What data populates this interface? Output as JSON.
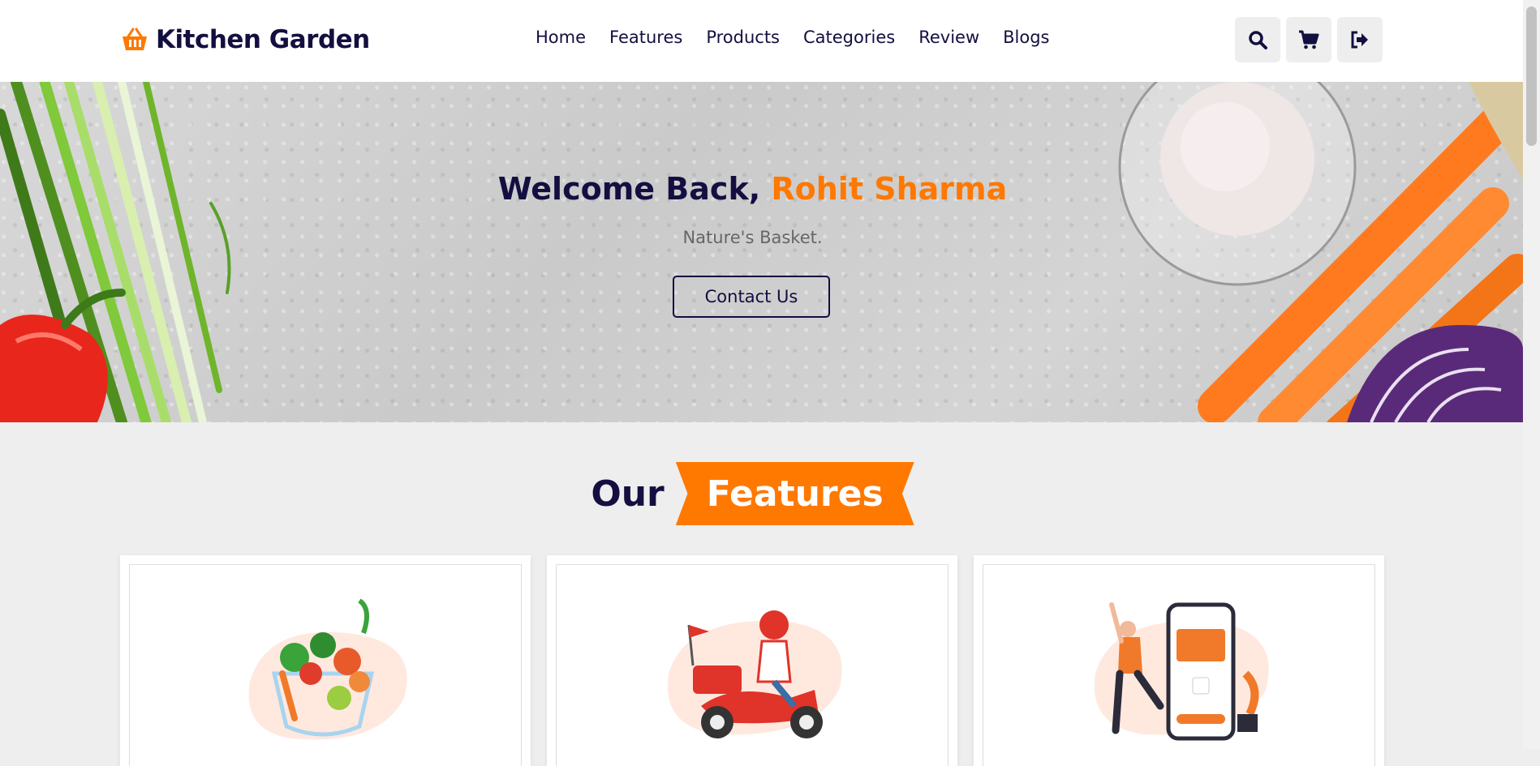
{
  "brand": {
    "name": "Kitchen Garden",
    "icon": "basket-icon",
    "accent": "#ff7800",
    "dark": "#130f40"
  },
  "nav": {
    "items": [
      "Home",
      "Features",
      "Products",
      "Categories",
      "Review",
      "Blogs"
    ]
  },
  "header_icons": [
    "search-icon",
    "cart-icon",
    "logout-icon"
  ],
  "hero": {
    "welcome": "Welcome Back, ",
    "user_name": "Rohit Sharma",
    "subtitle": "Nature's Basket.",
    "button_label": "Contact Us"
  },
  "features": {
    "heading_part1": "Our",
    "heading_part2": "Features",
    "cards": [
      {
        "image": "fresh-vegetables-illustration"
      },
      {
        "image": "delivery-scooter-illustration"
      },
      {
        "image": "mobile-payment-illustration"
      }
    ]
  }
}
